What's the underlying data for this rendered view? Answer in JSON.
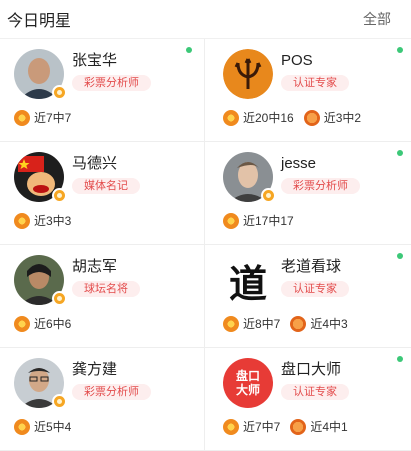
{
  "header": {
    "title": "今日明星",
    "all_link": "全部"
  },
  "experts": [
    {
      "name": "张宝华",
      "tag": "彩票分析师",
      "online": true,
      "avatar": "person-photo-bald-man",
      "stats": [
        {
          "icon": "soccer-ball-icon",
          "text": "近7中7"
        }
      ]
    },
    {
      "name": "POS",
      "tag": "认证专家",
      "online": true,
      "avatar": "trident-logo",
      "stats": [
        {
          "icon": "soccer-ball-icon",
          "text": "近20中16"
        },
        {
          "icon": "basketball-icon",
          "text": "近3中2"
        }
      ]
    },
    {
      "name": "马德兴",
      "tag": "媒体名记",
      "online": false,
      "avatar": "cartoon-flag-avatar",
      "stats": [
        {
          "icon": "soccer-ball-icon",
          "text": "近3中3"
        }
      ]
    },
    {
      "name": "jesse",
      "tag": "彩票分析师",
      "online": true,
      "avatar": "person-photo-young-man",
      "stats": [
        {
          "icon": "soccer-ball-icon",
          "text": "近17中17"
        }
      ]
    },
    {
      "name": "胡志军",
      "tag": "球坛名将",
      "online": false,
      "avatar": "person-photo-man",
      "stats": [
        {
          "icon": "soccer-ball-icon",
          "text": "近6中6"
        }
      ]
    },
    {
      "name": "老道看球",
      "tag": "认证专家",
      "online": true,
      "avatar": "calligraphy-dao-logo",
      "avatar_text": "道",
      "stats": [
        {
          "icon": "soccer-ball-icon",
          "text": "近8中7"
        },
        {
          "icon": "basketball-icon",
          "text": "近4中3"
        }
      ]
    },
    {
      "name": "龚方建",
      "tag": "彩票分析师",
      "online": false,
      "avatar": "person-photo-glasses-man",
      "stats": [
        {
          "icon": "soccer-ball-icon",
          "text": "近5中4"
        }
      ]
    },
    {
      "name": "盘口大师",
      "tag": "认证专家",
      "online": true,
      "avatar": "pankou-dashi-logo",
      "avatar_text_1": "盘口",
      "avatar_text_2": "大师",
      "stats": [
        {
          "icon": "soccer-ball-icon",
          "text": "近7中7"
        },
        {
          "icon": "basketball-icon",
          "text": "近4中1"
        }
      ]
    }
  ],
  "colors": {
    "tag_text": "#e34c4c",
    "tag_bg": "#fdeeee",
    "online_dot": "#3cc878",
    "accent_orange": "#f6a623"
  }
}
